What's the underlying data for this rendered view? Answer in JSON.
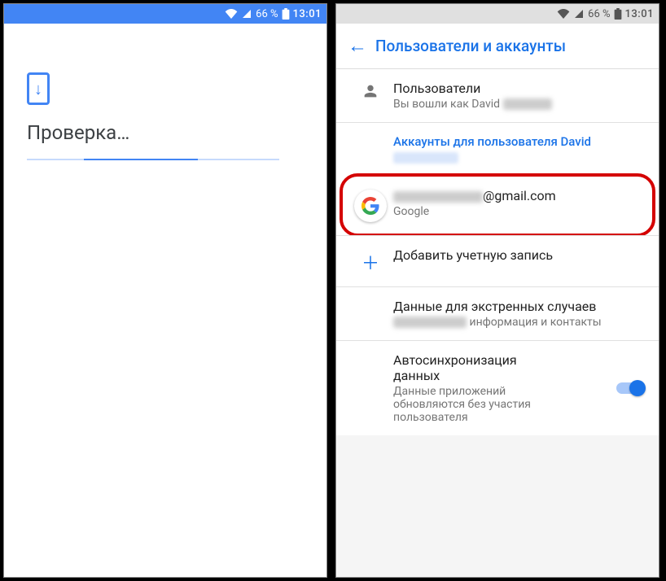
{
  "status": {
    "battery_pct": "66 %",
    "time": "13:01"
  },
  "screen1": {
    "title": "Проверка…"
  },
  "screen2": {
    "header_title": "Пользователи и аккаунты",
    "users_row": {
      "title": "Пользователи",
      "subtitle_prefix": "Вы вошли как David"
    },
    "accounts_section_label": "Аккаунты для пользователя David",
    "google_account": {
      "email_suffix": "@gmail.com",
      "provider": "Google"
    },
    "add_account_label": "Добавить учетную запись",
    "emergency": {
      "title": "Данные для экстренных случаев",
      "subtitle_suffix": "информация и контакты"
    },
    "autosync": {
      "title": "Автосинхронизация данных",
      "subtitle": "Данные приложений обновляются без участия пользователя"
    }
  }
}
